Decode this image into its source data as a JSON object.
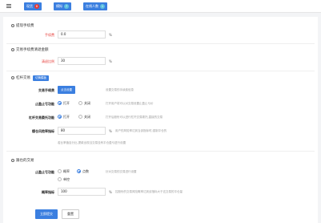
{
  "topbar": {
    "buttons": [
      {
        "label": "现货",
        "badge": "8",
        "badge_color": "#e53935"
      },
      {
        "label": "模拟",
        "badge": "7",
        "badge_color": "#5bc0de"
      },
      {
        "label": "在线人数",
        "badge": "1",
        "badge_color": "#5bc0de"
      }
    ]
  },
  "fees": {
    "title": "提现手续费",
    "fee_label": "手续费",
    "fee_value": "0.0",
    "unit": "%"
  },
  "trade_fees": {
    "title": "交易手续费清退金额",
    "ratio_label": "清退比例",
    "ratio_value": "30",
    "unit": "%"
  },
  "leverage": {
    "title": "杠杆交易",
    "mode_button": "切换模板",
    "trade_fee_label": "交易手续费",
    "trade_fee_button": "点击设置",
    "trade_fee_hint": "设置交易的手续费信息",
    "stoploss_label": "止盈止亏功能",
    "stoploss_on": "打开",
    "stoploss_off": "关闭",
    "stoploss_hint": "打开用户将可以对交易设置止盈止亏价",
    "leverage_label": "杠杆交易委托功能",
    "leverage_on": "打开",
    "leverage_off": "关闭",
    "leverage_hint": "打开后股份可以进行杠杆交易委托,直接的交易",
    "blowup_label": "爆仓风险率指标",
    "blowup_value": "80",
    "blowup_unit": "%",
    "blowup_hint": "用户的风险率达到当该指标时,强制平仓的",
    "note": "若比率值百分比,提款出现当交易没有平仓盈亏进行设置"
  },
  "follow": {
    "title": "跟也的交易",
    "stop_label": "止盈止亏功能",
    "opt1": "概率",
    "opt2": "点数",
    "opt3": "单控",
    "stop_hint": "针对交易的交易进行设置",
    "prob_label": "概率指标",
    "prob_value": "100",
    "prob_unit": "%",
    "prob_hint": "控股份的交易风险概率达到该指标大于这交易的平仓量"
  },
  "actions": {
    "submit": "立即提交",
    "reset": "重置"
  }
}
